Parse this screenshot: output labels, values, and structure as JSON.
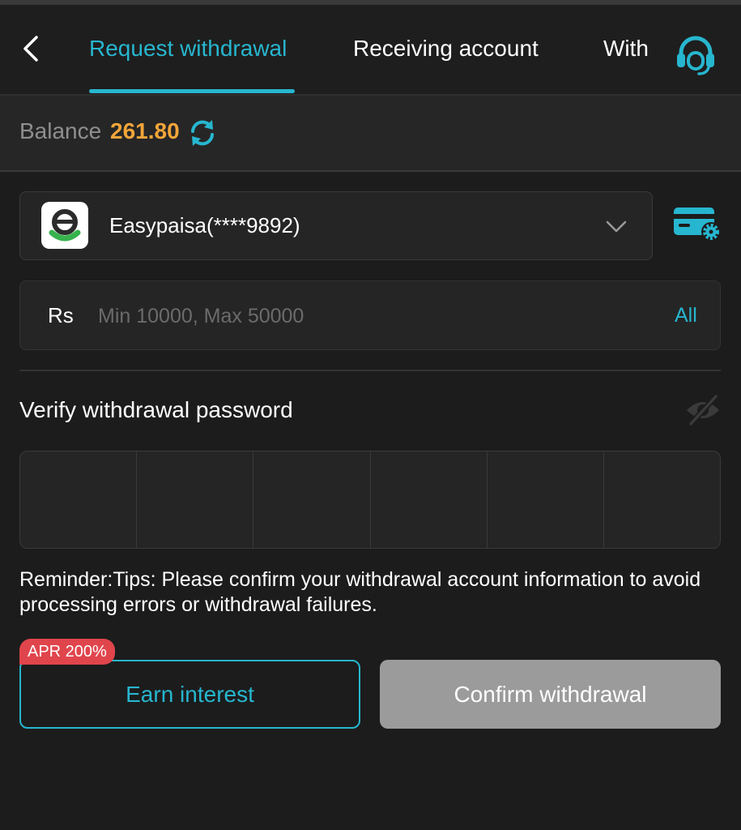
{
  "header": {
    "back_icon": "chevron-left-icon",
    "tabs": [
      {
        "label": "Request withdrawal",
        "active": true
      },
      {
        "label": "Receiving account",
        "active": false
      },
      {
        "label": "With",
        "active": false
      }
    ],
    "support_icon": "headset-icon"
  },
  "balance": {
    "label": "Balance",
    "value": "261.80",
    "refresh_icon": "refresh-icon"
  },
  "account": {
    "name": "Easypaisa(****9892)",
    "logo_icon": "easypaisa-logo",
    "dropdown_icon": "chevron-down-icon",
    "settings_icon": "card-settings-icon"
  },
  "amount": {
    "currency": "Rs",
    "placeholder": "Min 10000, Max 50000",
    "value": "",
    "all_label": "All"
  },
  "password": {
    "label": "Verify withdrawal password",
    "visibility_icon": "eye-slash-icon",
    "digits": [
      "",
      "",
      "",
      "",
      "",
      ""
    ]
  },
  "reminder": "Reminder:Tips: Please confirm your withdrawal account information to avoid processing errors or withdrawal failures.",
  "actions": {
    "earn_label": "Earn interest",
    "apr_badge": "APR 200%",
    "confirm_label": "Confirm withdrawal"
  },
  "colors": {
    "accent": "#27b6cf",
    "balance": "#f2a53a",
    "badge": "#e0454c",
    "disabled_button": "#9b9b9b",
    "background": "#1c1c1c"
  }
}
